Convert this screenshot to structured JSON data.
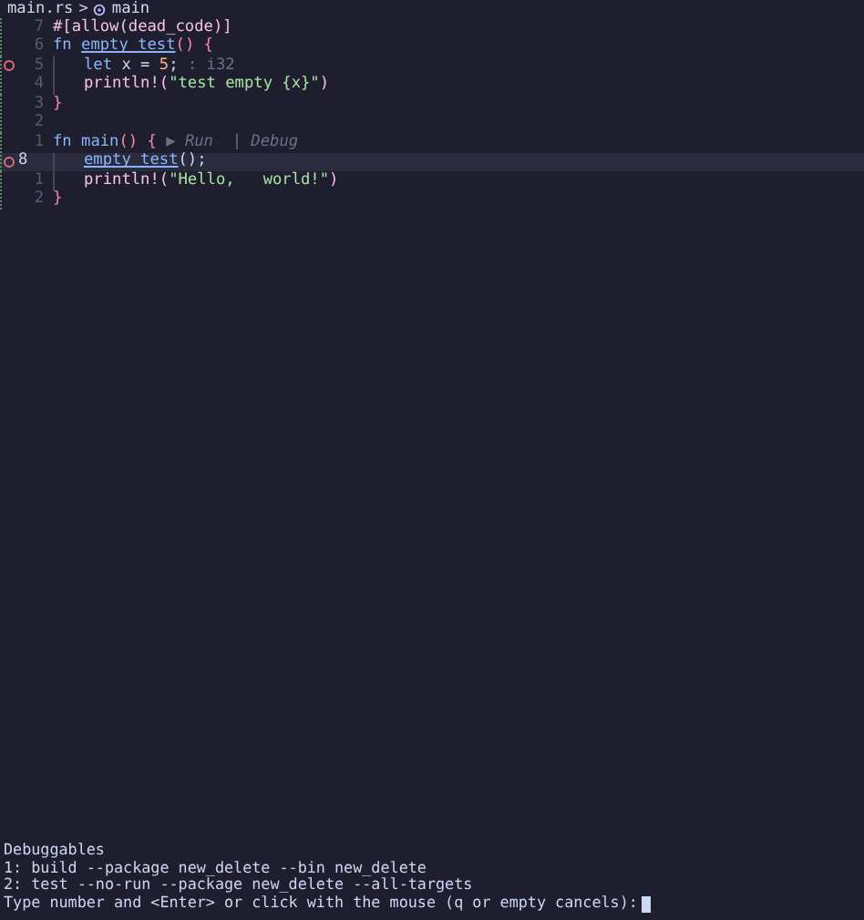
{
  "breadcrumb": {
    "file": "main.rs",
    "separator": ">",
    "symbol": "main"
  },
  "lines": [
    {
      "number": "7",
      "current": false,
      "breakpoint": false,
      "kind": "top",
      "tokens": [
        {
          "kind": "attr",
          "text": "#[allow(dead_code)]"
        }
      ]
    },
    {
      "number": "6",
      "current": false,
      "breakpoint": false,
      "kind": "top",
      "tokens": [
        {
          "kind": "kw",
          "text": "fn "
        },
        {
          "kind": "fnref",
          "text": "empty_test"
        },
        {
          "kind": "bracket",
          "text": "() {"
        }
      ]
    },
    {
      "number": "5",
      "current": false,
      "breakpoint": true,
      "kind": "inner",
      "tokens": [
        {
          "kind": "kw",
          "text": "let "
        },
        {
          "kind": "plain",
          "text": "x = "
        },
        {
          "kind": "num",
          "text": "5"
        },
        {
          "kind": "plain",
          "text": ";"
        },
        {
          "kind": "hint",
          "text": " : i32"
        }
      ]
    },
    {
      "number": "4",
      "current": false,
      "breakpoint": false,
      "kind": "inner",
      "tokens": [
        {
          "kind": "macro",
          "text": "println!("
        },
        {
          "kind": "str",
          "text": "\"test empty {x}\""
        },
        {
          "kind": "macro",
          "text": ")"
        }
      ]
    },
    {
      "number": "3",
      "current": false,
      "breakpoint": false,
      "kind": "top",
      "tokens": [
        {
          "kind": "bracket",
          "text": "}"
        }
      ]
    },
    {
      "number": "2",
      "current": false,
      "breakpoint": false,
      "kind": "top"
    },
    {
      "number": "1",
      "current": false,
      "breakpoint": false,
      "kind": "top",
      "tokens": [
        {
          "kind": "kw",
          "text": "fn "
        },
        {
          "kind": "fn",
          "text": "main"
        },
        {
          "kind": "bracket",
          "text": "() {"
        },
        {
          "kind": "lens",
          "text": " ▶ Run  | Debug"
        }
      ]
    },
    {
      "number": "8",
      "current": true,
      "breakpoint": true,
      "kind": "inner",
      "tokens": [
        {
          "kind": "fnref",
          "text": "empty_test"
        },
        {
          "kind": "plain",
          "text": "();"
        }
      ]
    },
    {
      "number": "1",
      "current": false,
      "breakpoint": false,
      "kind": "inner",
      "tokens": [
        {
          "kind": "macro",
          "text": "println!("
        },
        {
          "kind": "str",
          "text": "\"Hello,   world!\""
        },
        {
          "kind": "macro",
          "text": ")"
        }
      ]
    },
    {
      "number": "2",
      "current": false,
      "breakpoint": false,
      "kind": "top",
      "tokens": [
        {
          "kind": "bracket",
          "text": "}"
        }
      ]
    }
  ],
  "terminal": [
    "Debuggables",
    "1: build --package new_delete --bin new_delete",
    "2: test --no-run --package new_delete --all-targets",
    "Type number and <Enter> or click with the mouse (q or empty cancels):"
  ]
}
